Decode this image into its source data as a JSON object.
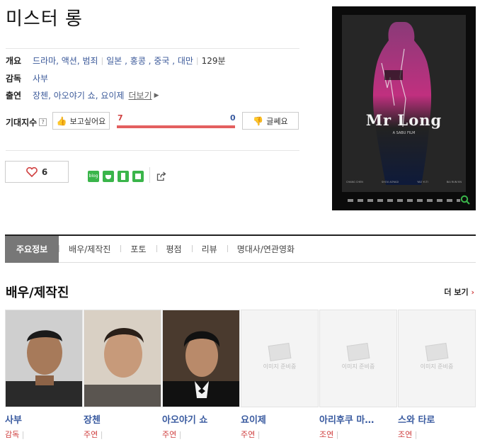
{
  "movie": {
    "title": "미스터 롱",
    "genre_label": "개요",
    "genres": "드라마, 액션, 범죄",
    "countries": "일본 , 홍콩 , 중국 , 대만",
    "runtime": "129분",
    "director_label": "감독",
    "director": "사부",
    "cast_label": "출연",
    "cast": "장첸, 아오야기 쇼, 요이제",
    "cast_more": "더보기"
  },
  "expectation": {
    "label": "기대지수",
    "help": "?",
    "want_button": "보고싶어요",
    "want_count": "7",
    "dislike_count": "0",
    "dislike_button": "글쎄요",
    "want_ratio": 1.0,
    "bar_color": "#e35f5f",
    "count_color": "#d04040",
    "dislike_color": "#3a5ba0"
  },
  "like": {
    "count": "6"
  },
  "share": {
    "icons": [
      "blog-icon",
      "cafe-icon",
      "bookmark-icon",
      "memo-icon",
      "share-icon"
    ],
    "blog_label": "blog"
  },
  "poster": {
    "title_text": "Mr Long",
    "sub_text": "A SABU FILM",
    "credits": [
      "CHANG CHEN",
      "SHOU AOYAGI",
      "YAO YI-TI",
      "BAI RUN-YIN"
    ]
  },
  "tabs": [
    "주요정보",
    "배우/제작진",
    "포토",
    "평점",
    "리뷰",
    "명대사/연관영화"
  ],
  "cast_section": {
    "title": "배우/제작진",
    "more": "더 보기",
    "no_image": "이미지 준비중",
    "people": [
      {
        "name": "사부",
        "role": "감독"
      },
      {
        "name": "장첸",
        "role": "주연"
      },
      {
        "name": "아오야기 쇼",
        "role": "주연"
      },
      {
        "name": "요이제",
        "role": "주연"
      },
      {
        "name": "아리후쿠 마…",
        "role": "조연"
      },
      {
        "name": "스와 타로",
        "role": "조연"
      }
    ]
  },
  "colors": {
    "accent_link": "#3a5ba0",
    "tab_active": "#777777",
    "heart": "#d04040",
    "share_green": "#3ab54a"
  }
}
